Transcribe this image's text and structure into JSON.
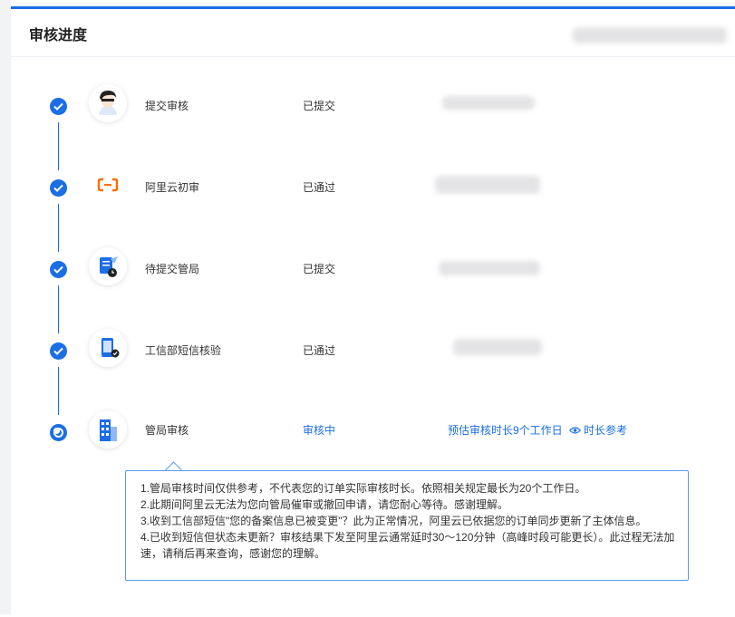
{
  "header": {
    "title": "审核进度"
  },
  "steps": [
    {
      "name": "提交审核",
      "status": "已提交",
      "icon": "avatar-icon",
      "state": "done"
    },
    {
      "name": "阿里云初审",
      "status": "已通过",
      "icon": "aliyun-logo-icon",
      "state": "done"
    },
    {
      "name": "待提交管局",
      "status": "已提交",
      "icon": "document-clock-icon",
      "state": "done"
    },
    {
      "name": "工信部短信核验",
      "status": "已通过",
      "icon": "phone-sms-icon",
      "state": "done"
    },
    {
      "name": "管局审核",
      "status": "审核中",
      "icon": "building-icon",
      "state": "current"
    }
  ],
  "current_step": {
    "estimate_text": "预估审核时长9个工作日",
    "reference_link": "时长参考",
    "reference_icon": "eye-icon"
  },
  "notes": [
    "1.管局审核时间仅供参考，不代表您的订单实际审核时长。依照相关规定最长为20个工作日。",
    "2.此期间阿里云无法为您向管局催审或撤回申请，请您耐心等待。感谢理解。",
    "3.收到工信部短信\"您的备案信息已被变更\"？此为正常情况，阿里云已依据您的订单同步更新了主体信息。",
    "4.已收到短信但状态未更新？审核结果下发至阿里云通常延时30～120分钟（高峰时段可能更长）。此过程无法加速，请稍后再来查询，感谢您的理解。"
  ],
  "colors": {
    "primary": "#1b6ee6",
    "aliyun_orange": "#ff6a00"
  }
}
